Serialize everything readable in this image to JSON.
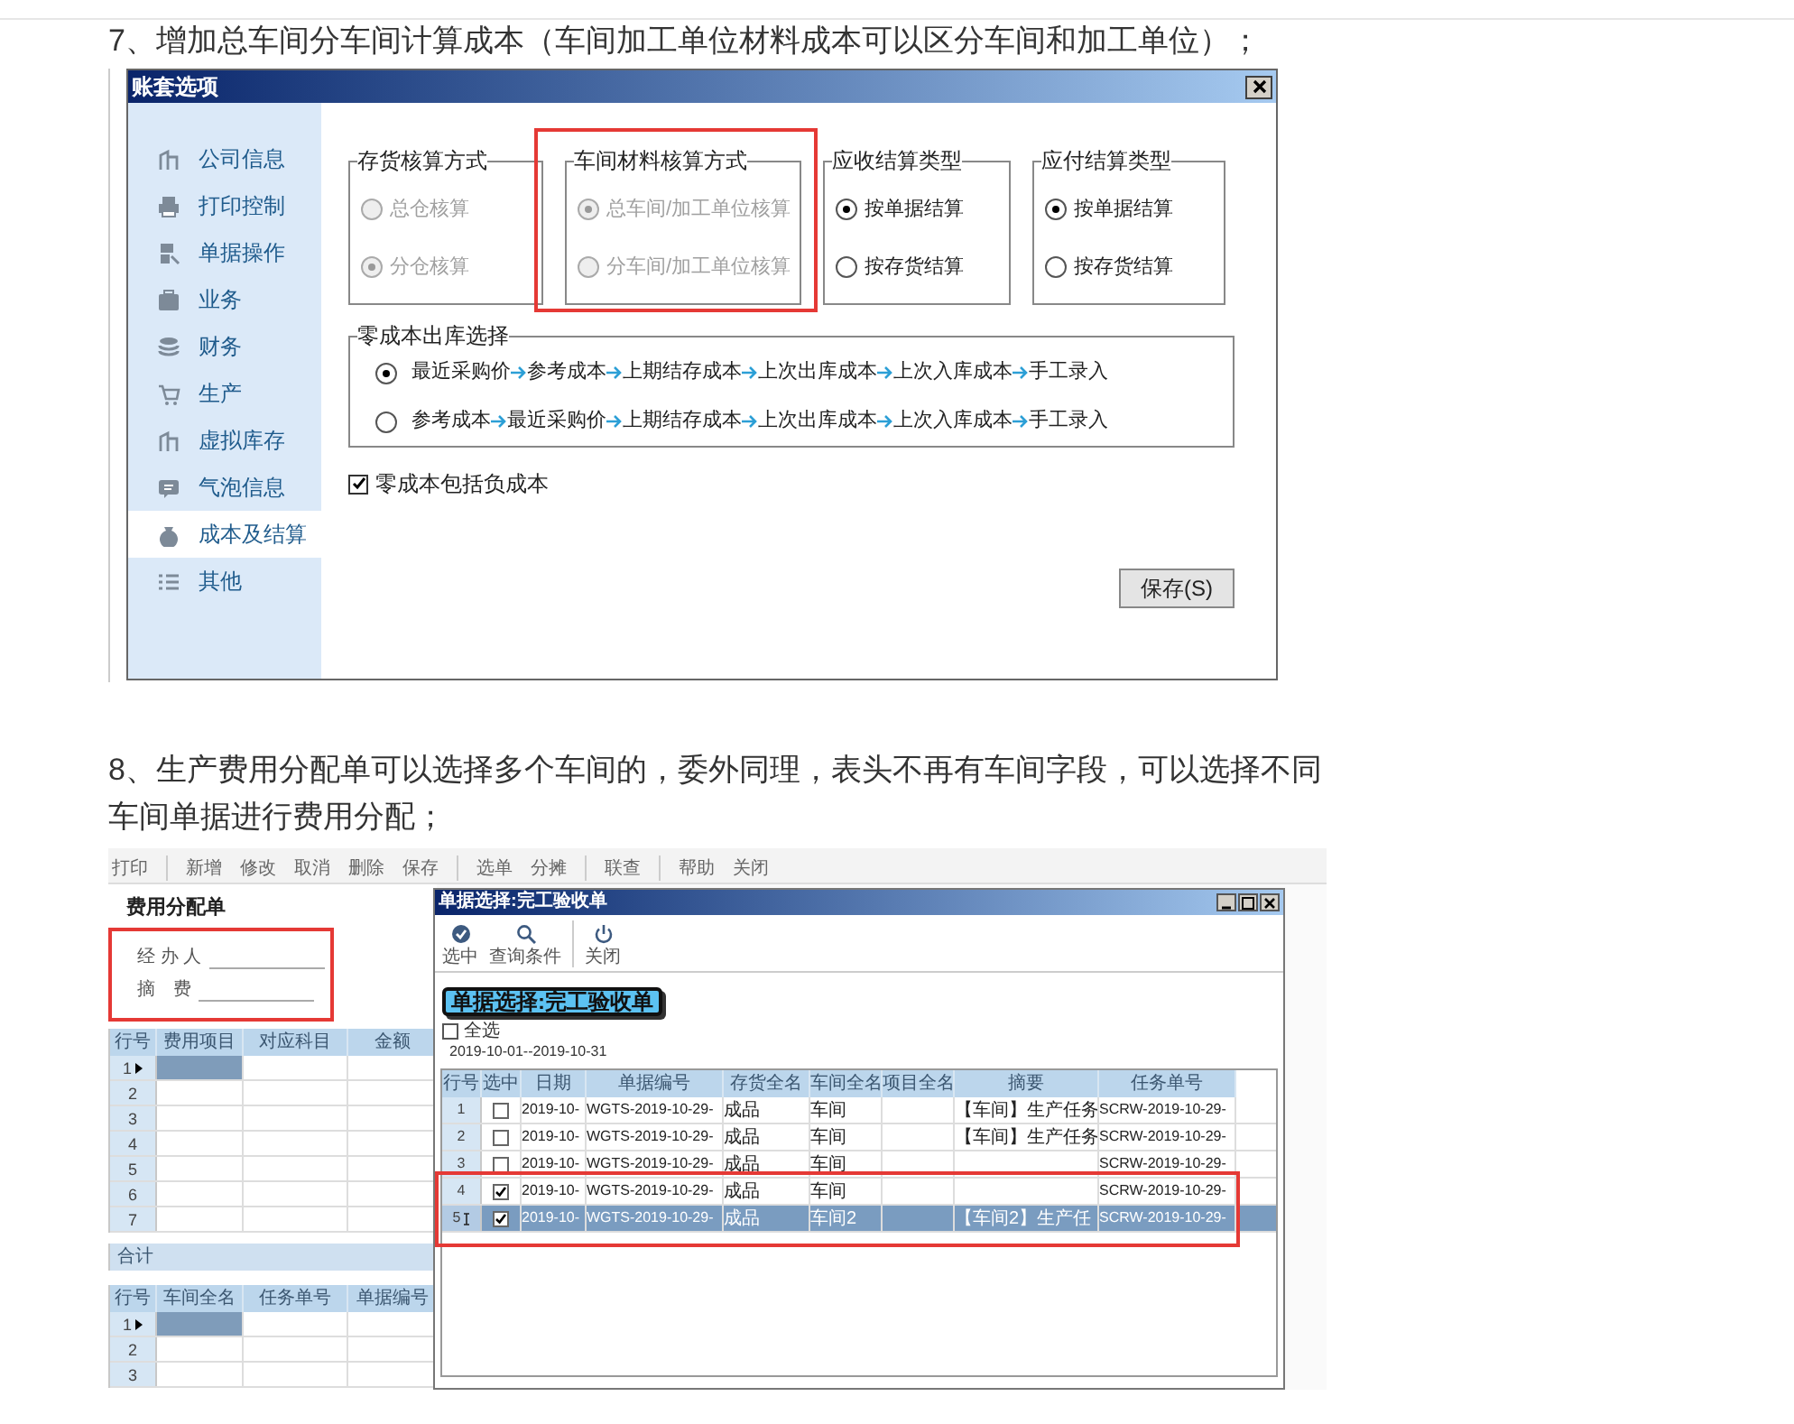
{
  "heading_7": "7、增加总车间分车间计算成本（车间加工单位材料成本可以区分车间和加工单位）；",
  "dialog_1": {
    "title": "账套选项",
    "sidebar": [
      {
        "label": "公司信息",
        "selected": false
      },
      {
        "label": "打印控制",
        "selected": false
      },
      {
        "label": "单据操作",
        "selected": false
      },
      {
        "label": "业务",
        "selected": false
      },
      {
        "label": "财务",
        "selected": false
      },
      {
        "label": "生产",
        "selected": false
      },
      {
        "label": "虚拟库存",
        "selected": false
      },
      {
        "label": "气泡信息",
        "selected": false
      },
      {
        "label": "成本及结算",
        "selected": true
      },
      {
        "label": "其他",
        "selected": false
      }
    ],
    "groups": [
      {
        "title": "存货核算方式",
        "disabled": true,
        "highlighted": false,
        "options": [
          {
            "label": "总仓核算",
            "selected": false
          },
          {
            "label": "分仓核算",
            "selected": true
          }
        ]
      },
      {
        "title": "车间材料核算方式",
        "disabled": true,
        "highlighted": true,
        "options": [
          {
            "label": "总车间/加工单位核算",
            "selected": true
          },
          {
            "label": "分车间/加工单位核算",
            "selected": false
          }
        ]
      },
      {
        "title": "应收结算类型",
        "disabled": false,
        "highlighted": false,
        "options": [
          {
            "label": "按单据结算",
            "selected": true
          },
          {
            "label": "按存货结算",
            "selected": false
          }
        ]
      },
      {
        "title": "应付结算类型",
        "disabled": false,
        "highlighted": false,
        "options": [
          {
            "label": "按单据结算",
            "selected": true
          },
          {
            "label": "按存货结算",
            "selected": false
          }
        ]
      }
    ],
    "zero_cost": {
      "title": "零成本出库选择",
      "options": [
        {
          "selected": true,
          "steps": [
            "最近采购价",
            "参考成本",
            "上期结存成本",
            "上次出库成本",
            "上次入库成本",
            "手工录入"
          ]
        },
        {
          "selected": false,
          "steps": [
            "参考成本",
            "最近采购价",
            "上期结存成本",
            "上次出库成本",
            "上次入库成本",
            "手工录入"
          ]
        }
      ]
    },
    "checkbox": {
      "label": "零成本包括负成本",
      "checked": true
    },
    "save_button": "保存(S)"
  },
  "heading_8": "8、生产费用分配单可以选择多个车间的，委外同理，表头不再有车间字段，可以选择不同车间单据进行费用分配；",
  "screenshot_2": {
    "toolbar": [
      "打印",
      "新增",
      "修改",
      "取消",
      "删除",
      "保存",
      "选单",
      "分摊",
      "联查",
      "帮助",
      "关闭"
    ],
    "form_title": "费用分配单",
    "fields": [
      {
        "label": "经 办 人"
      },
      {
        "label": "摘　费"
      }
    ],
    "fields_highlighted": true,
    "table_1": {
      "columns": [
        "行号",
        "费用项目",
        "对应科目",
        "金额"
      ],
      "rows": [
        {
          "number": "1",
          "current": true
        },
        {
          "number": "2",
          "current": false
        },
        {
          "number": "3",
          "current": false
        },
        {
          "number": "4",
          "current": false
        },
        {
          "number": "5",
          "current": false
        },
        {
          "number": "6",
          "current": false
        },
        {
          "number": "7",
          "current": false
        }
      ],
      "total_label": "合计"
    },
    "table_2": {
      "columns": [
        "行号",
        "车间全名",
        "任务单号",
        "单据编号"
      ],
      "rows": [
        {
          "number": "1",
          "current": true
        },
        {
          "number": "2",
          "current": false
        },
        {
          "number": "3",
          "current": false
        }
      ]
    },
    "modal": {
      "title": "单据选择:完工验收单",
      "toolbar": [
        "选中",
        "查询条件",
        "关闭"
      ],
      "banner": "单据选择:完工验收单",
      "select_all": {
        "label": "全选",
        "checked": false
      },
      "date_range": "2019-10-01--2019-10-31",
      "highlight_checked_rows": true,
      "columns": [
        "行号",
        "选中",
        "日期",
        "单据编号",
        "存货全名",
        "车间全名",
        "项目全名",
        "摘要",
        "任务单号"
      ],
      "rows": [
        {
          "checked": false,
          "selected": false,
          "cells": [
            "1",
            "",
            "2019-10-",
            "WGTS-2019-10-29-",
            "成品",
            "车间",
            "",
            "【车间】生产任务",
            "SCRW-2019-10-29-"
          ]
        },
        {
          "checked": false,
          "selected": false,
          "cells": [
            "2",
            "",
            "2019-10-",
            "WGTS-2019-10-29-",
            "成品",
            "车间",
            "",
            "【车间】生产任务",
            "SCRW-2019-10-29-"
          ]
        },
        {
          "checked": false,
          "selected": false,
          "cells": [
            "3",
            "",
            "2019-10-",
            "WGTS-2019-10-29-",
            "成品",
            "车间",
            "",
            "",
            "SCRW-2019-10-29-"
          ]
        },
        {
          "checked": true,
          "selected": false,
          "cells": [
            "4",
            "",
            "2019-10-",
            "WGTS-2019-10-29-",
            "成品",
            "车间",
            "",
            "",
            "SCRW-2019-10-29-"
          ]
        },
        {
          "checked": true,
          "selected": true,
          "cells": [
            "5",
            "",
            "2019-10-",
            "WGTS-2019-10-29-",
            "成品",
            "车间2",
            "",
            "【车间2】生产任",
            "SCRW-2019-10-29-"
          ]
        }
      ]
    }
  }
}
